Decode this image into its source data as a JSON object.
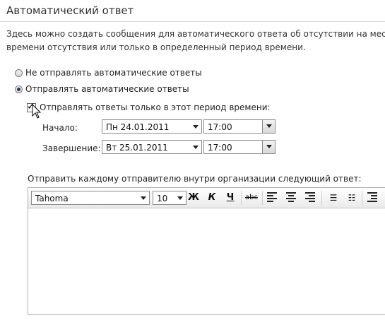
{
  "header": {
    "title": "Автоматический ответ"
  },
  "description": {
    "line1": "Здесь можно создать сообщения для автоматического ответа об отсутствии на месте.",
    "line2": "времени отсутствия или только в определенный период времени."
  },
  "options": {
    "no_send": "Не отправлять автоматические ответы",
    "send": "Отправлять автоматические ответы",
    "selected": "send"
  },
  "period": {
    "checkbox_label": "Отправлять ответы только в этот период времени:",
    "checked": true,
    "start_label": "Начало:",
    "start_date": "Пн 24.01.2011",
    "start_time": "17:00",
    "end_label": "Завершение:",
    "end_date": "Вт 25.01.2011",
    "end_time": "17:00"
  },
  "reply": {
    "label": "Отправить каждому отправителю внутри организации следующий ответ:",
    "font_name": "Tahoma",
    "font_size": "10",
    "bold": "Ж",
    "italic": "К",
    "underline": "Ч",
    "strikethrough": "abc"
  }
}
